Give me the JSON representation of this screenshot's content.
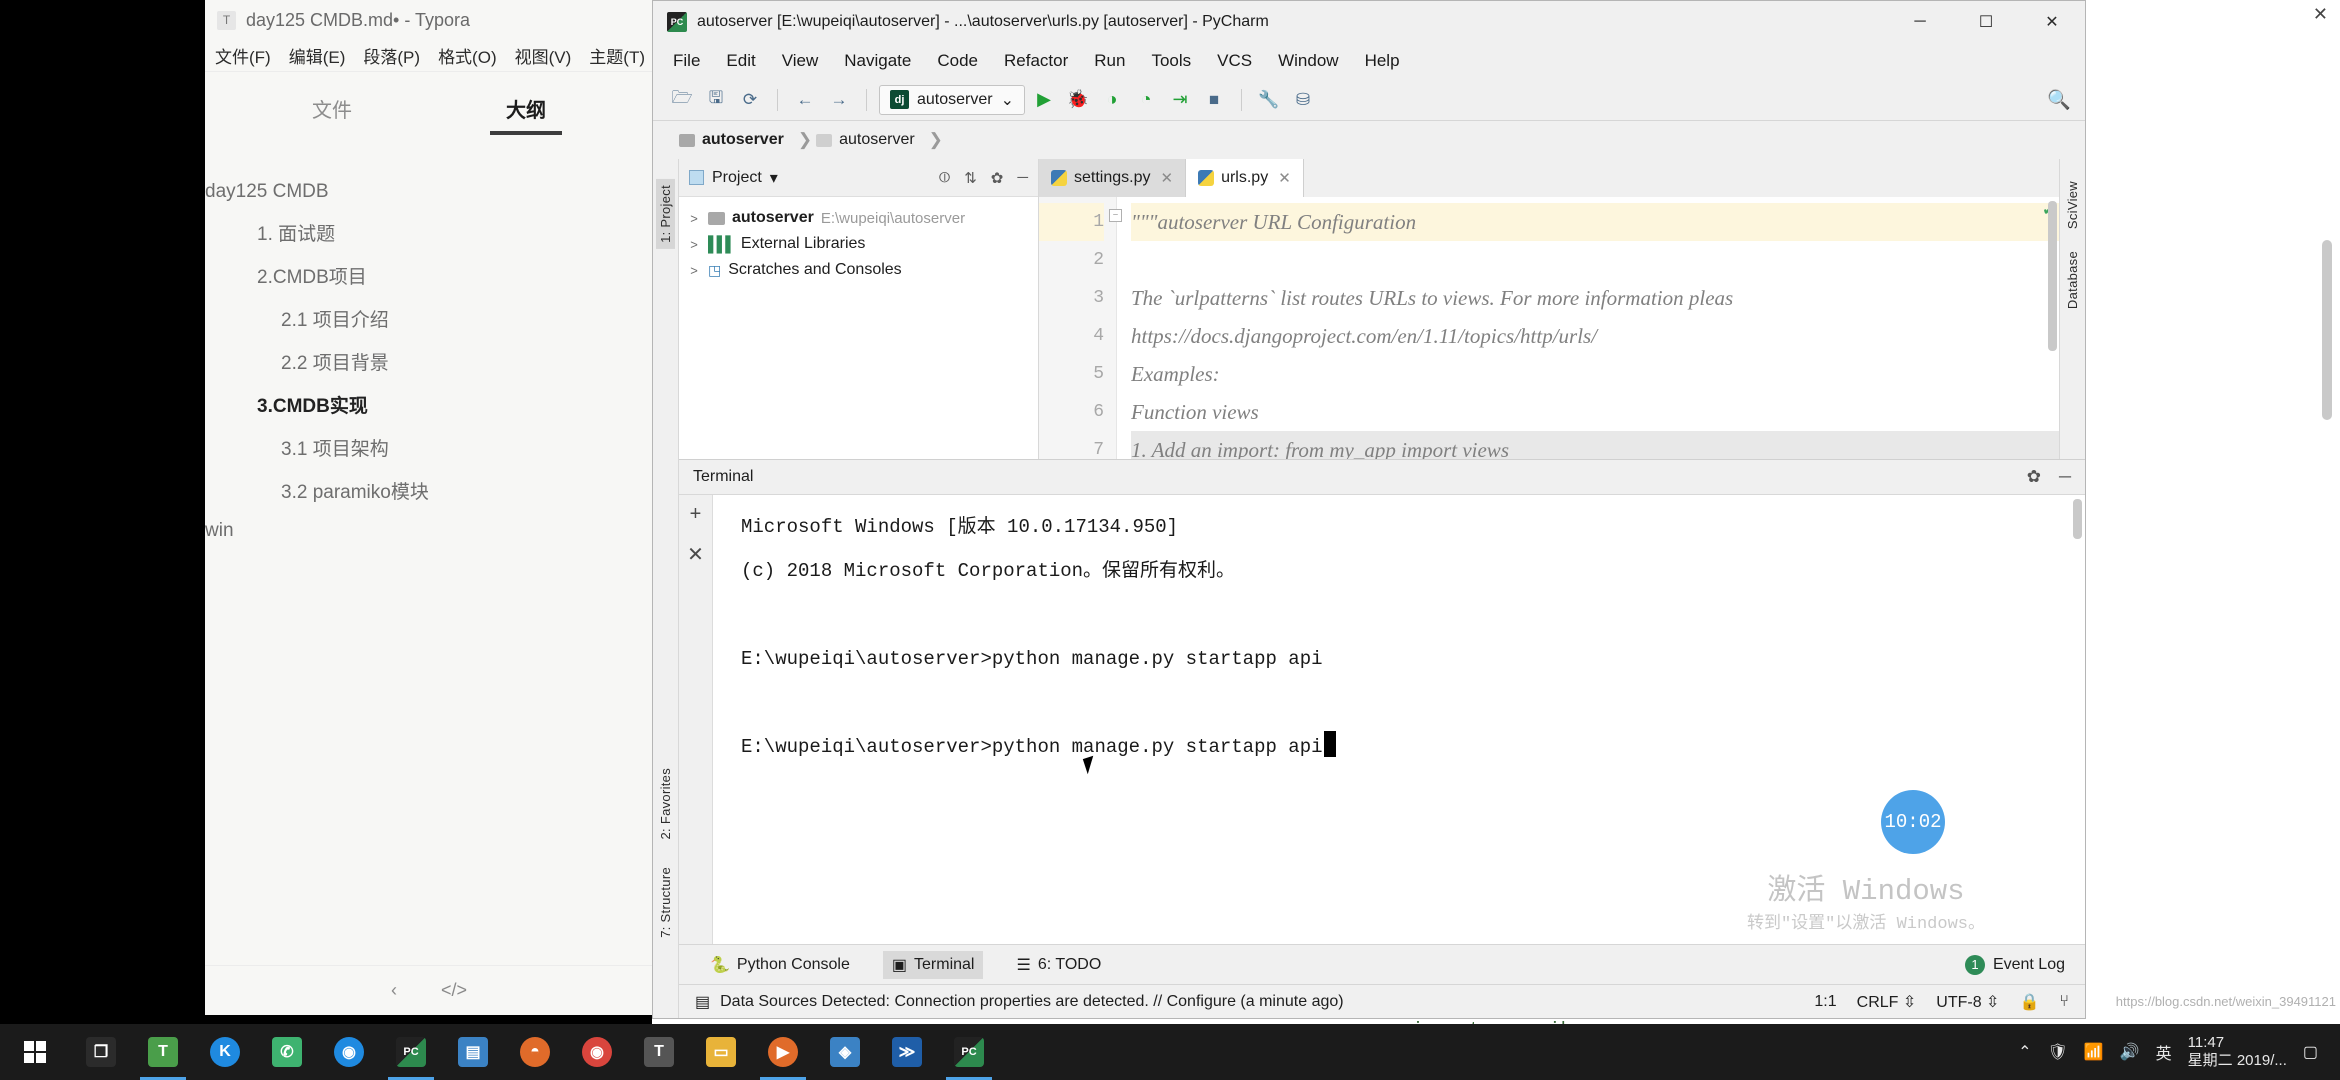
{
  "typora": {
    "title": "day125 CMDB.md• - Typora",
    "badge": "T",
    "menu": [
      "文件(F)",
      "编辑(E)",
      "段落(P)",
      "格式(O)",
      "视图(V)",
      "主题(T)"
    ],
    "tabs": [
      {
        "label": "文件",
        "active": false
      },
      {
        "label": "大纲",
        "active": true
      }
    ],
    "outline": [
      {
        "label": "day125 CMDB",
        "level": 0,
        "bold": false
      },
      {
        "label": "1. 面试题",
        "level": 1,
        "bold": false
      },
      {
        "label": "2.CMDB项目",
        "level": 1,
        "bold": false
      },
      {
        "label": "2.1 项目介绍",
        "level": 2,
        "bold": false
      },
      {
        "label": "2.2 项目背景",
        "level": 2,
        "bold": false
      },
      {
        "label": "3.CMDB实现",
        "level": 1,
        "bold": true
      },
      {
        "label": "3.1 项目架构",
        "level": 2,
        "bold": false
      },
      {
        "label": "3.2 paramiko模块",
        "level": 2,
        "bold": false
      },
      {
        "label": "win",
        "level": 0,
        "bold": false
      }
    ],
    "footer": {
      "back_icon": "‹",
      "source_icon": "</>"
    }
  },
  "pycharm": {
    "title": "autoserver [E:\\wupeiqi\\autoserver] - ...\\autoserver\\urls.py [autoserver] - PyCharm",
    "logo_text": "PC",
    "window_buttons": {
      "minimize": "─",
      "maximize": "☐",
      "close": "✕"
    },
    "menu": [
      "File",
      "Edit",
      "View",
      "Navigate",
      "Code",
      "Refactor",
      "Run",
      "Tools",
      "VCS",
      "Window",
      "Help"
    ],
    "toolbar": {
      "open_icon": "🗁",
      "save_icon": "🖫",
      "sync_icon": "⟳",
      "back_icon": "←",
      "forward_icon": "→",
      "run_config": "autoserver",
      "run_config_icon": "dj",
      "run_config_caret": "⌄",
      "run_icon": "▶",
      "debug_icon": "🐞",
      "coverage_icon": "◑",
      "profile_icon": "◔",
      "run_with_icon": "⇥",
      "stop_icon": "■",
      "settings_icon": "🔧",
      "struct_icon": "⛁",
      "search_icon": "🔍"
    },
    "breadcrumbs": [
      "autoserver",
      "autoserver"
    ],
    "left_tool_buttons": [
      "1: Project",
      "2: Favorites",
      "7: Structure"
    ],
    "right_tool_buttons": [
      "SciView",
      "Database"
    ],
    "project_panel": {
      "title": "Project",
      "caret": "▾",
      "icons": [
        "⦶",
        "⇅",
        "✿",
        "─"
      ],
      "tree": [
        {
          "arrow": ">",
          "icon": "folder-icon",
          "label": "autoserver",
          "path": "E:\\wupeiqi\\autoserver",
          "bold": true
        },
        {
          "arrow": ">",
          "icon": "library-icon",
          "label": "External Libraries",
          "path": "",
          "bold": false
        },
        {
          "arrow": ">",
          "icon": "scratches-icon",
          "label": "Scratches and Consoles",
          "path": "",
          "bold": false
        }
      ]
    },
    "editor": {
      "tabs": [
        {
          "label": "settings.py",
          "active": false,
          "close": "✕"
        },
        {
          "label": "urls.py",
          "active": true,
          "close": "✕"
        }
      ],
      "lines": [
        {
          "no": "1",
          "text": "\"\"\"autoserver URL Configuration",
          "highlight": true
        },
        {
          "no": "2",
          "text": "",
          "highlight": false
        },
        {
          "no": "3",
          "text": "The `urlpatterns` list routes URLs to views. For more information pleas",
          "highlight": false
        },
        {
          "no": "4",
          "text": "    https://docs.djangoproject.com/en/1.11/topics/http/urls/",
          "highlight": false
        },
        {
          "no": "5",
          "text": "Examples:",
          "highlight": false
        },
        {
          "no": "6",
          "text": "Function views",
          "highlight": false
        },
        {
          "no": "7",
          "text": "    1. Add an import:  from my_app import views",
          "highlight": false
        }
      ]
    },
    "terminal": {
      "title": "Terminal",
      "gear_icon": "✿",
      "minimize_icon": "─",
      "add_icon": "+",
      "close_icon": "✕",
      "lines": [
        "Microsoft Windows [版本 10.0.17134.950]",
        "(c) 2018 Microsoft Corporation。保留所有权利。",
        "",
        "E:\\wupeiqi\\autoserver>python manage.py startapp api",
        "",
        "E:\\wupeiqi\\autoserver>python manage.py startapp api"
      ],
      "timer_badge": "10:02"
    },
    "bottom_tabs": [
      {
        "label": "Python Console",
        "icon": "python-icon",
        "selected": false
      },
      {
        "label": "Terminal",
        "icon": "terminal-icon",
        "selected": true
      },
      {
        "label": "6: TODO",
        "icon": "todo-icon",
        "selected": false
      }
    ],
    "event_log": "Event Log",
    "status": {
      "message": "Data Sources Detected: Connection properties are detected. // Configure (a minute ago)",
      "caret_position": "1:1",
      "line_separator": "CRLF",
      "encoding": "UTF-8",
      "lock_icon": "🔒",
      "branch_icon": "⑂"
    },
    "behind_code": "import paramiko"
  },
  "windows_watermark": {
    "line1": "激活 Windows",
    "line2": "转到\"设置\"以激活 Windows。"
  },
  "right_edge": {
    "close_icon": "✕",
    "url": "https://blog.csdn.net/weixin_39491121"
  },
  "taskbar": {
    "items": [
      {
        "name": "task-view",
        "glyph": "❐",
        "color": "#1b1b1b",
        "active": false
      },
      {
        "name": "typora",
        "glyph": "T",
        "color": "#4a9e4a",
        "active": true
      },
      {
        "name": "kugou",
        "glyph": "K",
        "color": "#1f8ae0",
        "active": false
      },
      {
        "name": "wechat",
        "glyph": "✆",
        "color": "#3eb370",
        "active": false
      },
      {
        "name": "chrome",
        "glyph": "◉",
        "color": "#1f8ae0",
        "active": false
      },
      {
        "name": "pycharm",
        "glyph": "PC",
        "color": "#2d8a4e",
        "active": true
      },
      {
        "name": "folder-blue",
        "glyph": "📁",
        "color": "#3b82c4",
        "active": false
      },
      {
        "name": "firefox",
        "glyph": "◓",
        "color": "#e06b2a",
        "active": false
      },
      {
        "name": "chrome2",
        "glyph": "◉",
        "color": "#d44",
        "active": false
      },
      {
        "name": "typora2",
        "glyph": "T",
        "color": "#555",
        "active": false
      },
      {
        "name": "explorer",
        "glyph": "📁",
        "color": "#e8b339",
        "active": false
      },
      {
        "name": "video-player",
        "glyph": "▶",
        "color": "#e06b2a",
        "active": true
      },
      {
        "name": "store",
        "glyph": "◈",
        "color": "#3b82c4",
        "active": false
      },
      {
        "name": "powershell",
        "glyph": "≫",
        "color": "#1f5ea8",
        "active": false
      },
      {
        "name": "pycharm2",
        "glyph": "PC",
        "color": "#2d8a4e",
        "active": true
      }
    ],
    "tray": {
      "chevron": "⌃",
      "security_icon": "🛡",
      "network_icon": "📶",
      "volume_icon": "🔊",
      "ime": "英",
      "time": "11:47",
      "date": "星期二  2019/..."
    }
  }
}
